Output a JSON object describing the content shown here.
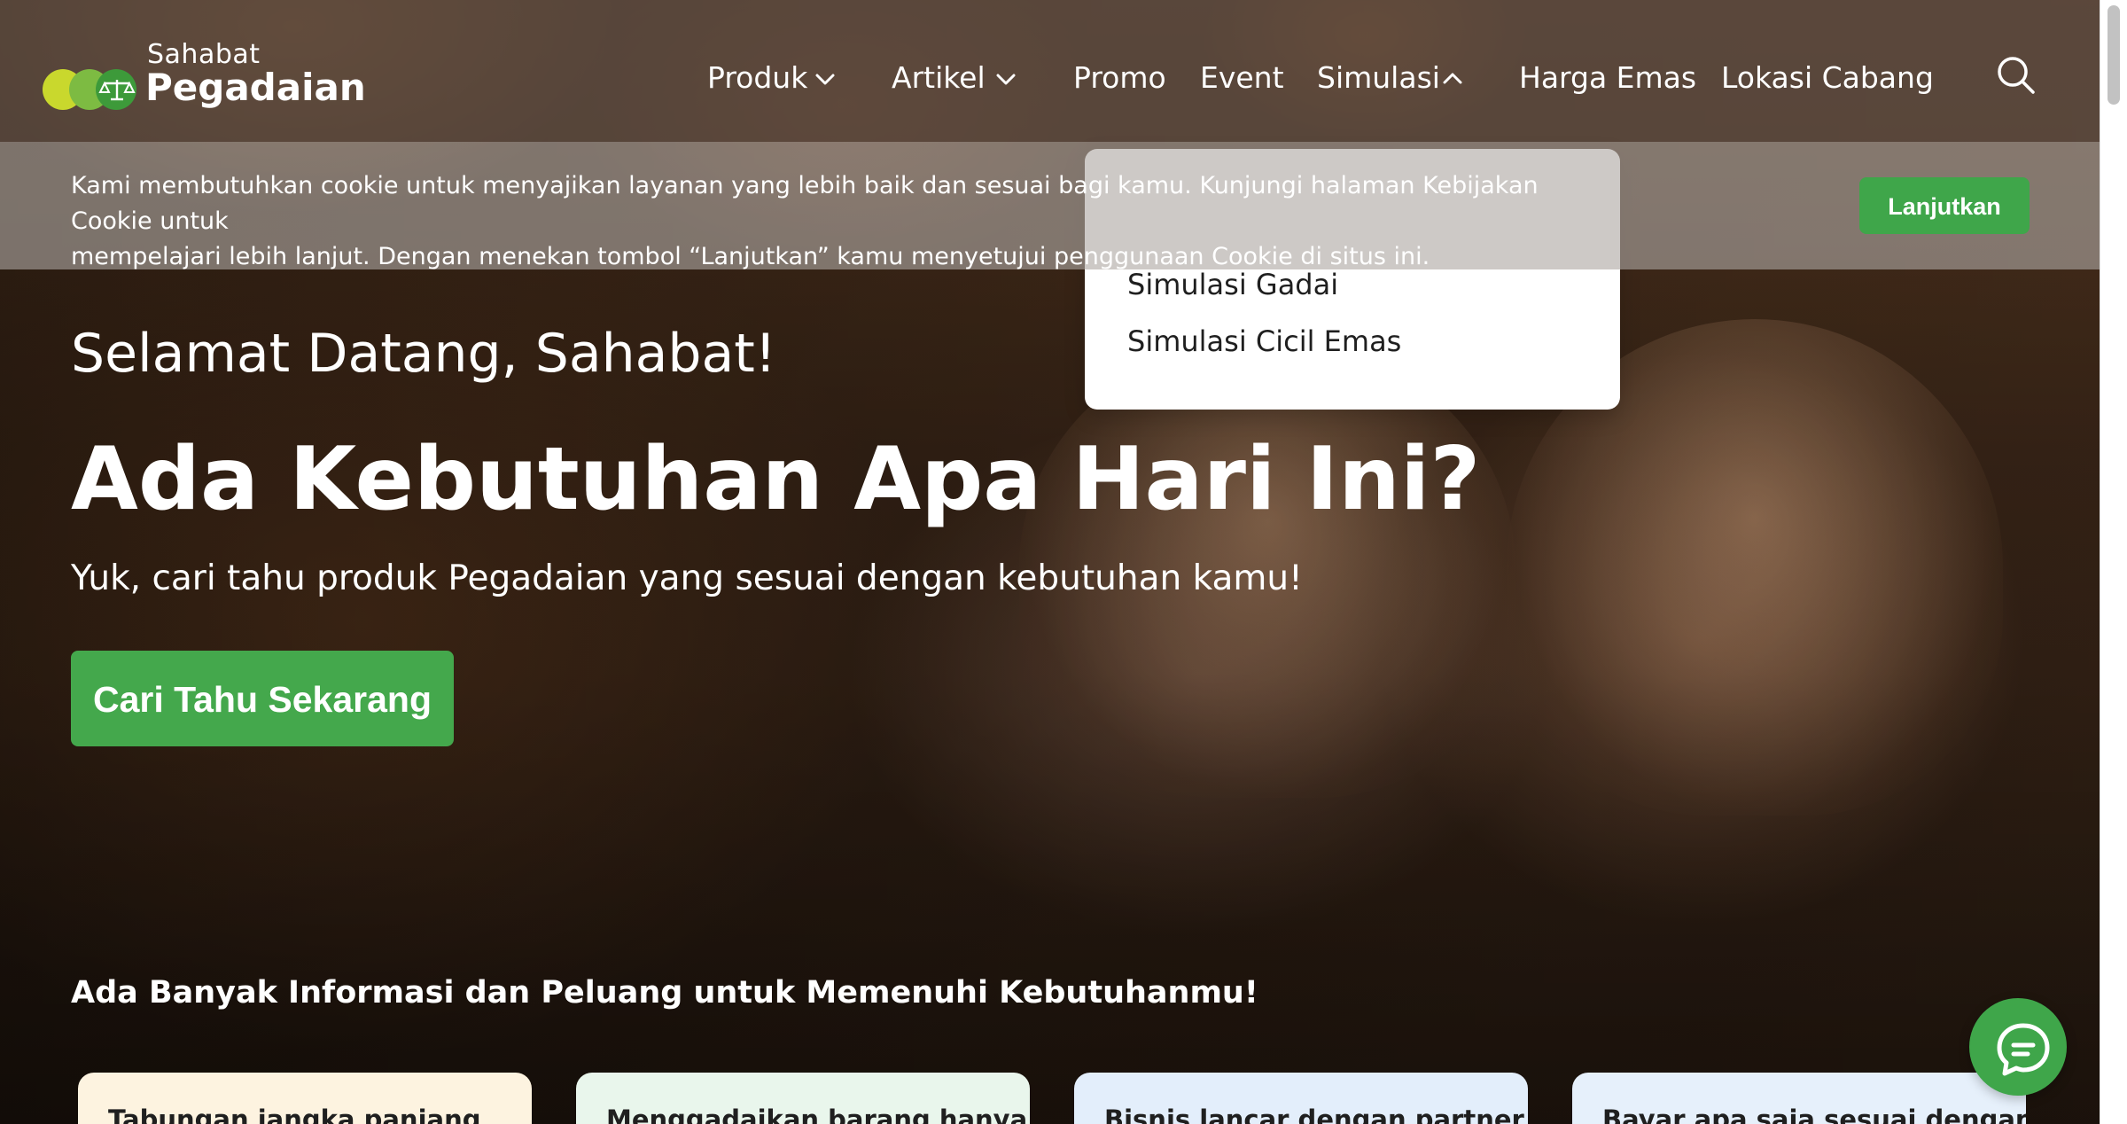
{
  "logo": {
    "top_text": "Sahabat",
    "bottom_text": "Pegadaian",
    "icon": "scale-icon",
    "colors": [
      "#c9d82d",
      "#7dbb42",
      "#3d9a3a"
    ]
  },
  "nav": {
    "items": [
      {
        "label": "Produk",
        "icon": "chevron-down-icon"
      },
      {
        "label": "Artikel",
        "icon": "chevron-down-icon"
      },
      {
        "label": "Promo"
      },
      {
        "label": "Event"
      },
      {
        "label": "Simulasi",
        "icon": "chevron-up-icon",
        "expanded": true
      },
      {
        "label": "Harga Emas"
      },
      {
        "label": "Lokasi Cabang"
      }
    ],
    "search_icon": "search-icon"
  },
  "cookie": {
    "line1": "Kami membutuhkan cookie untuk menyajikan layanan yang lebih baik dan sesuai bagi kamu. Kunjungi halaman Kebijakan Cookie untuk",
    "line2": "mempelajari lebih lanjut. Dengan menekan tombol “Lanjutkan” kamu menyetujui penggunaan Cookie di situs ini.",
    "button": "Lanjutkan"
  },
  "dropdown": {
    "items": [
      "Simulasi Gadai",
      "Simulasi Cicil Emas"
    ]
  },
  "hero": {
    "welcome": "Selamat Datang, Sahabat!",
    "headline": "Ada Kebutuhan Apa Hari Ini?",
    "subline": "Yuk, cari tahu produk Pegadaian yang sesuai dengan kebutuhan kamu!",
    "cta": "Cari Tahu Sekarang"
  },
  "section": {
    "title": "Ada Banyak Informasi dan Peluang untuk Memenuhi Kebutuhanmu!"
  },
  "cards": [
    {
      "text": "Tabungan jangka panjang",
      "bg": "#fdf3e0"
    },
    {
      "text": "Menggadaikan barang hanya",
      "bg": "#e9f6ec"
    },
    {
      "text": "Bisnis lancar dengan partner",
      "bg": "#e3eefb"
    },
    {
      "text": "Bayar apa saja sesuai dengan",
      "bg": "#e6f0fb"
    }
  ],
  "chat": {
    "icon": "chat-icon"
  },
  "colors": {
    "brand_green": "#3fa64a",
    "header_bg": "rgba(95,78,68,0.78)"
  }
}
